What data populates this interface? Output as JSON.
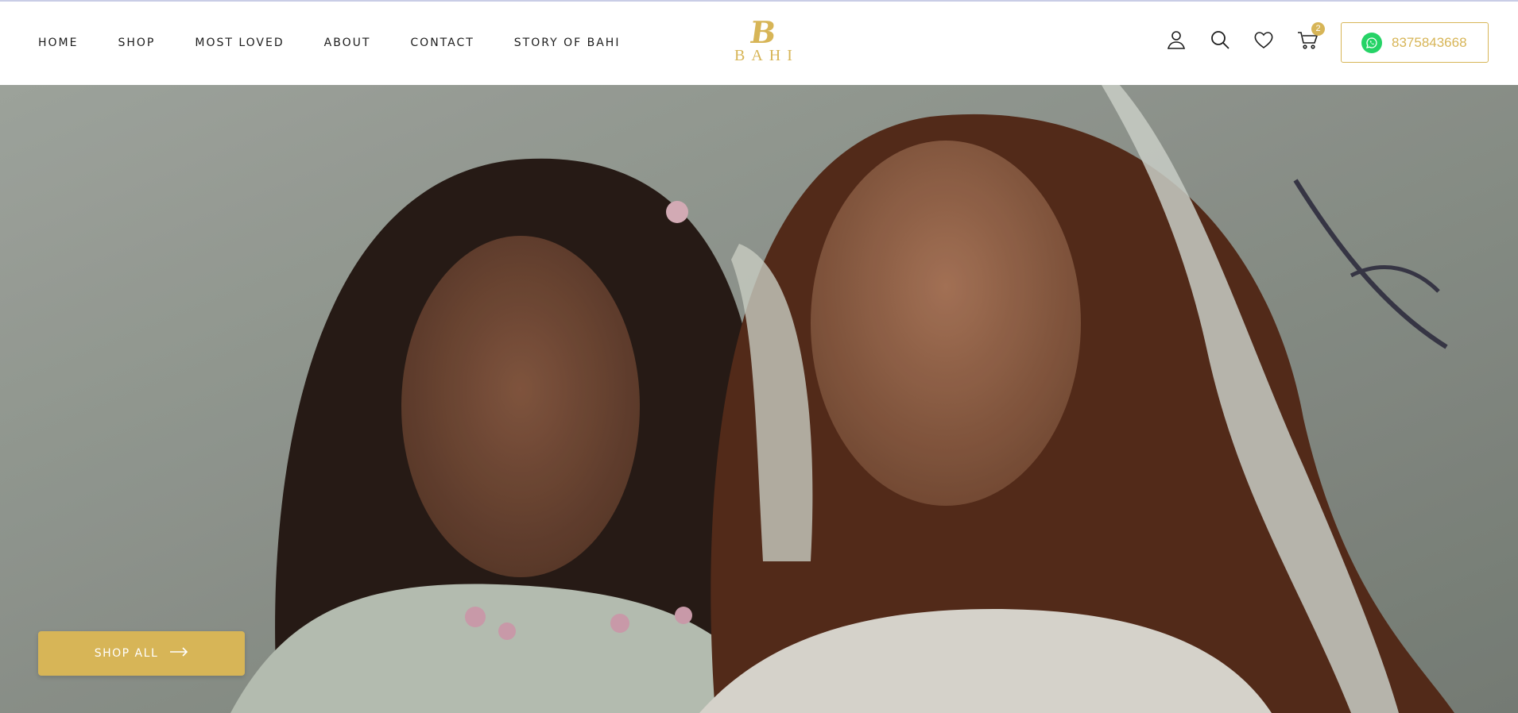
{
  "nav": {
    "items": [
      "HOME",
      "SHOP",
      "MOST LOVED",
      "ABOUT",
      "CONTACT",
      "STORY OF BAHI"
    ]
  },
  "logo": {
    "mark": "B",
    "text": "BAHI"
  },
  "header_icons": {
    "account": "user-icon",
    "search": "search-icon",
    "wishlist": "heart-icon",
    "cart": "cart-icon",
    "cart_count": "2"
  },
  "whatsapp": {
    "icon": "whatsapp-icon",
    "phone": "8375843668"
  },
  "hero": {
    "cta_label": "SHOP ALL",
    "cta_icon": "arrow-right-icon"
  },
  "colors": {
    "accent": "#d7b557",
    "text": "#1d1d1d",
    "whatsapp": "#25d366"
  }
}
